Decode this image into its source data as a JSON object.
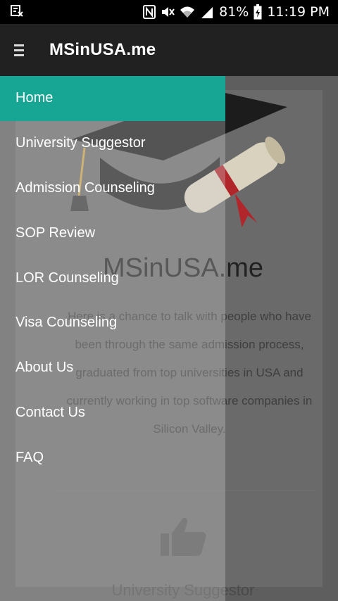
{
  "status_bar": {
    "battery": "81%",
    "time": "11:19 PM",
    "icons": [
      "screen-record-icon",
      "nfc-icon",
      "mute-icon",
      "wifi-icon",
      "signal-icon",
      "battery-icon"
    ]
  },
  "app_bar": {
    "title": "MSinUSA.me"
  },
  "drawer": {
    "items": [
      {
        "label": "Home",
        "active": true
      },
      {
        "label": "University Suggestor"
      },
      {
        "label": "Admission Counseling"
      },
      {
        "label": "SOP Review"
      },
      {
        "label": "LOR Counseling"
      },
      {
        "label": "Visa Counseling"
      },
      {
        "label": "About Us"
      },
      {
        "label": "Contact Us"
      },
      {
        "label": "FAQ"
      }
    ]
  },
  "content": {
    "title": "MSinUSA.me",
    "description": "Here is a chance to talk with people who have been through the same admission process, graduated from top universities in USA and currently working in top software companies in Silicon Valley.",
    "section_label": "University Suggestor",
    "icons": [
      "graduation-cap-diploma-icon",
      "thumbs-up-icon"
    ]
  },
  "colors": {
    "status_bar": "#000000",
    "app_bar": "#212121",
    "drawer_active": "#16a693"
  }
}
